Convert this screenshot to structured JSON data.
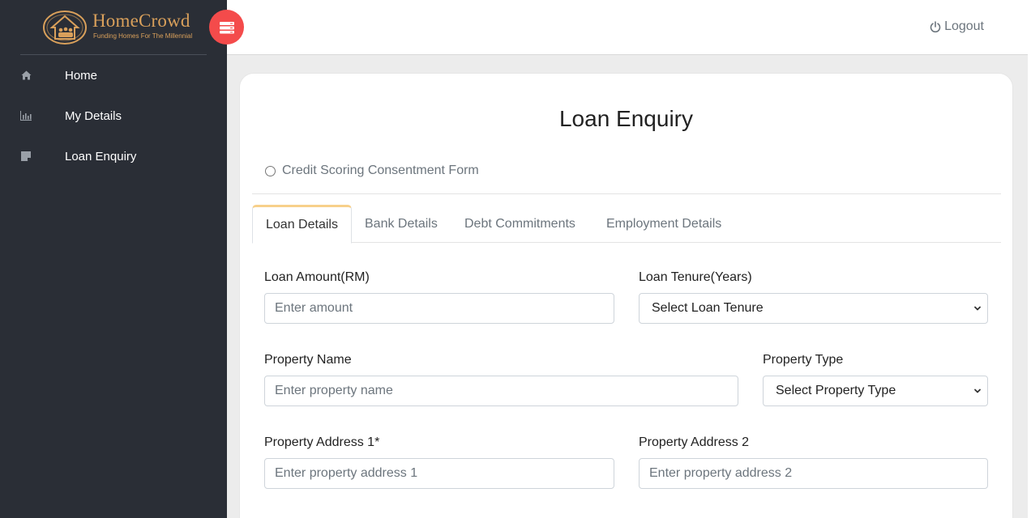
{
  "brand": {
    "name": "HomeCrowd",
    "tagline": "Funding Homes For The Millennial",
    "accent": "#d9a05b"
  },
  "sidebar": {
    "items": [
      {
        "label": "Home",
        "icon": "home-icon"
      },
      {
        "label": "My Details",
        "icon": "bar-chart-icon"
      },
      {
        "label": "Loan Enquiry",
        "icon": "note-icon"
      }
    ]
  },
  "topbar": {
    "logout_label": "Logout",
    "toggle_icon": "menu-stack-icon",
    "toggle_color": "#f44b4b"
  },
  "page": {
    "title": "Loan Enquiry",
    "consent_label": "Credit Scoring Consentment Form"
  },
  "tabs": [
    {
      "label": "Loan Details",
      "active": true
    },
    {
      "label": "Bank Details",
      "active": false
    },
    {
      "label": "Debt Commitments",
      "active": false
    },
    {
      "label": "Employment Details",
      "active": false
    }
  ],
  "form": {
    "loan_amount": {
      "label": "Loan Amount(RM)",
      "placeholder": "Enter amount"
    },
    "loan_tenure": {
      "label": "Loan Tenure(Years)",
      "selected": "Select Loan Tenure"
    },
    "property_name": {
      "label": "Property Name",
      "placeholder": "Enter property name"
    },
    "property_type": {
      "label": "Property Type",
      "selected": "Select Property Type"
    },
    "property_address_1": {
      "label": "Property Address 1*",
      "placeholder": "Enter property address 1"
    },
    "property_address_2": {
      "label": "Property Address 2",
      "placeholder": "Enter property address 2"
    }
  }
}
